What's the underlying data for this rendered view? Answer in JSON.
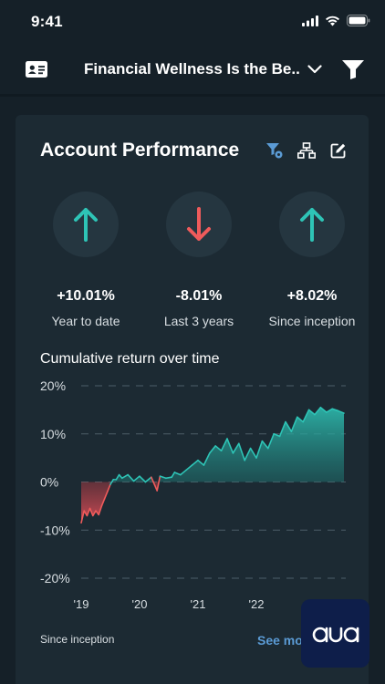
{
  "status": {
    "time": "9:41"
  },
  "nav": {
    "title": "Financial Wellness Is the Be.."
  },
  "card": {
    "title": "Account Performance",
    "metrics": [
      {
        "value": "+10.01%",
        "label": "Year to date",
        "direction": "up",
        "color": "#2ec4b6"
      },
      {
        "value": "-8.01%",
        "label": "Last 3 years",
        "direction": "down",
        "color": "#ef5b5b"
      },
      {
        "value": "+8.02%",
        "label": "Since inception",
        "direction": "up",
        "color": "#2ec4b6"
      }
    ],
    "chart_title": "Cumulative return over time",
    "footer_left": "Since inception",
    "footer_right": "See mo"
  },
  "colors": {
    "positive": "#2ec4b6",
    "negative": "#ef5b5b",
    "link": "#5b9bd5"
  },
  "chart_data": {
    "type": "area",
    "title": "Cumulative return over time",
    "y_ticks": [
      "20%",
      "10%",
      "0%",
      "-10%",
      "-20%"
    ],
    "x_ticks": [
      "'19",
      "'20",
      "'21",
      "'22"
    ],
    "ylim": [
      -20,
      20
    ],
    "grid": true,
    "x": [
      2019.0,
      2019.05,
      2019.1,
      2019.15,
      2019.2,
      2019.25,
      2019.3,
      2019.35,
      2019.4,
      2019.45,
      2019.5,
      2019.55,
      2019.6,
      2019.65,
      2019.7,
      2019.8,
      2019.9,
      2020.0,
      2020.1,
      2020.2,
      2020.3,
      2020.35,
      2020.45,
      2020.55,
      2020.6,
      2020.7,
      2020.8,
      2020.9,
      2021.0,
      2021.1,
      2021.2,
      2021.3,
      2021.4,
      2021.5,
      2021.6,
      2021.7,
      2021.8,
      2021.9,
      2022.0,
      2022.1,
      2022.2,
      2022.3,
      2022.4,
      2022.5,
      2022.6,
      2022.7,
      2022.8,
      2022.9,
      2023.0,
      2023.1,
      2023.2,
      2023.3,
      2023.4,
      2023.5
    ],
    "y": [
      -8.5,
      -6,
      -7,
      -5.5,
      -7,
      -6,
      -6.8,
      -5,
      -3.5,
      -2,
      -0.5,
      0.5,
      0.5,
      1.5,
      0.8,
      1.5,
      0.2,
      1.2,
      0,
      1,
      -1.8,
      1.2,
      0.8,
      1,
      2,
      1.5,
      2.5,
      3.5,
      4.5,
      3.5,
      6,
      7.5,
      6.5,
      9,
      6,
      8,
      4.5,
      7,
      5,
      8.5,
      7,
      10,
      9.5,
      12.5,
      10.5,
      13.5,
      12.5,
      15,
      14,
      15.5,
      14.5,
      15.2,
      14.8,
      14.3
    ]
  }
}
